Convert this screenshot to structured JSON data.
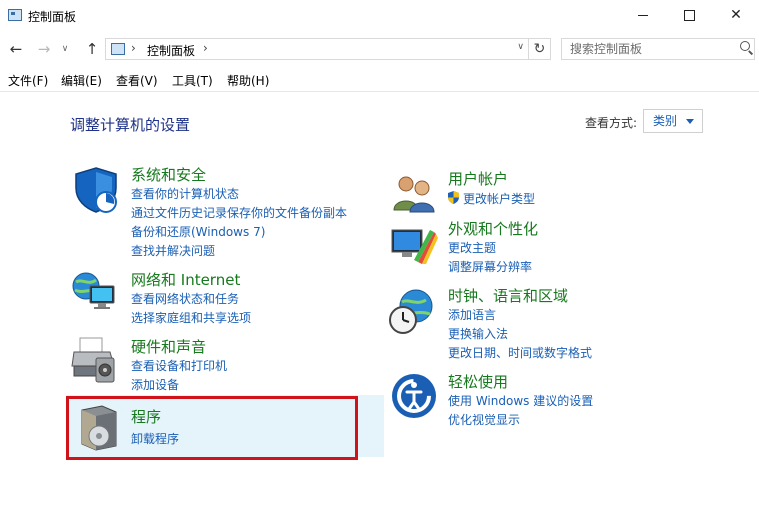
{
  "window": {
    "title": "控制面板",
    "min_glyph": "",
    "close_glyph": "✕"
  },
  "nav": {
    "back": "←",
    "forward": "→",
    "history": "∨",
    "up": "↑",
    "address_sep": "›",
    "address_text": "控制面板",
    "address_sep2": "›",
    "address_dropdown": "∨",
    "refresh": "↻",
    "search_placeholder": "搜索控制面板"
  },
  "menubar": {
    "items": [
      "文件(F)",
      "编辑(E)",
      "查看(V)",
      "工具(T)",
      "帮助(H)"
    ]
  },
  "main": {
    "heading": "调整计算机的设置",
    "view_by_label": "查看方式:",
    "view_by_value": "类别"
  },
  "categories": {
    "system_security": {
      "title": "系统和安全",
      "links": [
        "查看你的计算机状态",
        "通过文件历史记录保存你的文件备份副本",
        "备份和还原(Windows 7)",
        "查找并解决问题"
      ]
    },
    "network_internet": {
      "title": "网络和 Internet",
      "links": [
        "查看网络状态和任务",
        "选择家庭组和共享选项"
      ]
    },
    "hardware_sound": {
      "title": "硬件和声音",
      "links": [
        "查看设备和打印机",
        "添加设备"
      ]
    },
    "programs": {
      "title": "程序",
      "links": [
        "卸载程序"
      ]
    },
    "user_accounts": {
      "title": "用户帐户",
      "links": [
        "更改帐户类型"
      ]
    },
    "appearance": {
      "title": "外观和个性化",
      "links": [
        "更改主题",
        "调整屏幕分辨率"
      ]
    },
    "clock_region": {
      "title": "时钟、语言和区域",
      "links": [
        "添加语言",
        "更换输入法",
        "更改日期、时间或数字格式"
      ]
    },
    "ease_of_access": {
      "title": "轻松使用",
      "links": [
        "使用 Windows 建议的设置",
        "优化视觉显示"
      ]
    }
  },
  "colors": {
    "category_title": "#16791d",
    "link": "#1a5fb4",
    "heading": "#1e3287",
    "highlight_bg": "#e5f3fb",
    "annotation_border": "#d0121b"
  }
}
